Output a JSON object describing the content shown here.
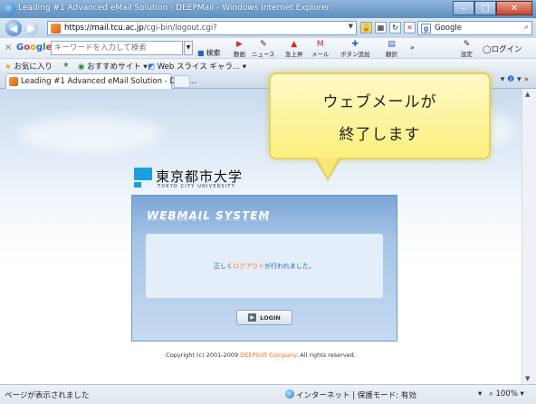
{
  "window": {
    "title": "Leading #1 Advanced eMail Solution - DEEPMail - Windows Internet Explorer"
  },
  "address": {
    "url_domain": "https://mail.tcu.ac.jp",
    "url_path": "/cgi-bin/logout.cgi?",
    "search_text": "Google"
  },
  "google_toolbar": {
    "logo": "Google",
    "search_placeholder": "キーワードを入力して検索",
    "search_button": "検索",
    "buttons": [
      "動画",
      "ニュース",
      "急上昇",
      "メール",
      "ボタン追加",
      "翻訳"
    ],
    "settings": "設定",
    "login": "ログイン"
  },
  "favorites": {
    "label": "お気に入り",
    "suggested": "おすすめサイト",
    "webslice": "Web スライス ギャラ..."
  },
  "tab": {
    "title": "Leading #1 Advanced eMail Solution - DEEP..."
  },
  "page": {
    "university_name": "東京都市大学",
    "university_en": "TOKYO CITY UNIVERSITY",
    "system_title": "WEBMAIL SYSTEM",
    "message_pre": "正しく",
    "message_highlight": "ログアウト",
    "message_post": "が行われました。",
    "login_button": "LOGIN",
    "copyright_pre": "Copyright (c) 2001-2009 ",
    "copyright_company": "DEEPSoft Company",
    "copyright_post": ". All rights reserved."
  },
  "callout": {
    "line1": "ウェブメールが",
    "line2": "終了します"
  },
  "status": {
    "left": "ページが表示されました",
    "zone": "インターネット | 保護モード: 有効",
    "zoom": "100%"
  }
}
